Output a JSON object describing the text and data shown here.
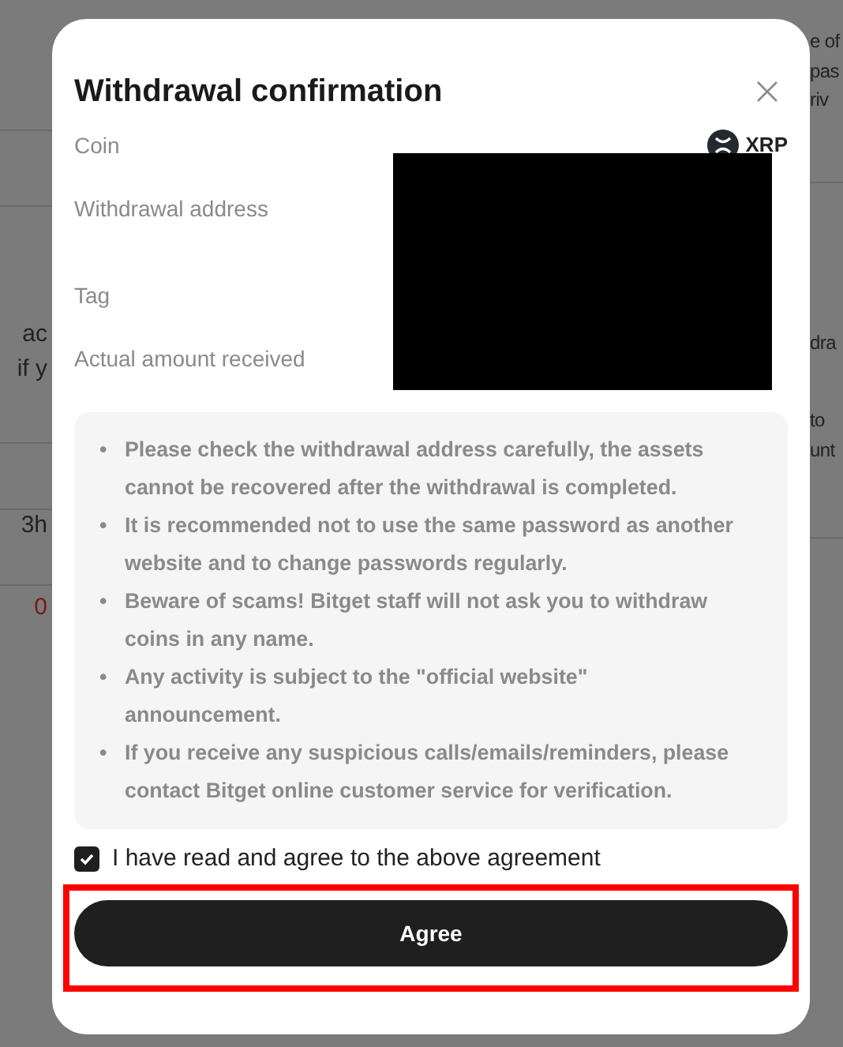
{
  "background": {
    "left": [
      {
        "text": "ac",
        "alert": false
      },
      {
        "text": "if y",
        "alert": false
      },
      {
        "text": "3h",
        "alert": false
      },
      {
        "text": "0",
        "alert": true
      }
    ],
    "right": [
      {
        "text": "e of",
        "alert": false
      },
      {
        "text": "pas",
        "alert": false
      },
      {
        "text": "riv",
        "alert": false
      },
      {
        "text": "dra",
        "alert": false
      },
      {
        "text": "to",
        "alert": false
      },
      {
        "text": "unt",
        "alert": false
      }
    ]
  },
  "dialog": {
    "title": "Withdrawal confirmation",
    "details": [
      {
        "label": "Coin",
        "value": "XRP"
      },
      {
        "label": "Withdrawal address"
      },
      {
        "label": "Tag"
      },
      {
        "label": "Actual amount received"
      }
    ],
    "redacted": true,
    "notices": [
      {
        "marker": "•",
        "text": "Please check the withdrawal address carefully, the assets cannot be recovered after the withdrawal is completed."
      },
      {
        "marker": "•",
        "text": "It is recommended not to use the same password as another website and to change passwords regularly."
      },
      {
        "marker": "•",
        "text": "Beware of scams! Bitget staff will not ask you to withdraw coins in any name."
      },
      {
        "marker": "•",
        "text": "Any activity is subject to the \"official website\" announcement."
      },
      {
        "marker": "•",
        "text": "If you receive any suspicious calls/emails/reminders, please contact Bitget online customer service for verification."
      }
    ],
    "agreement": {
      "label": "I have read and agree to the above agreement",
      "checked": true
    },
    "button": {
      "label": "Agree",
      "highlighted": true
    }
  }
}
